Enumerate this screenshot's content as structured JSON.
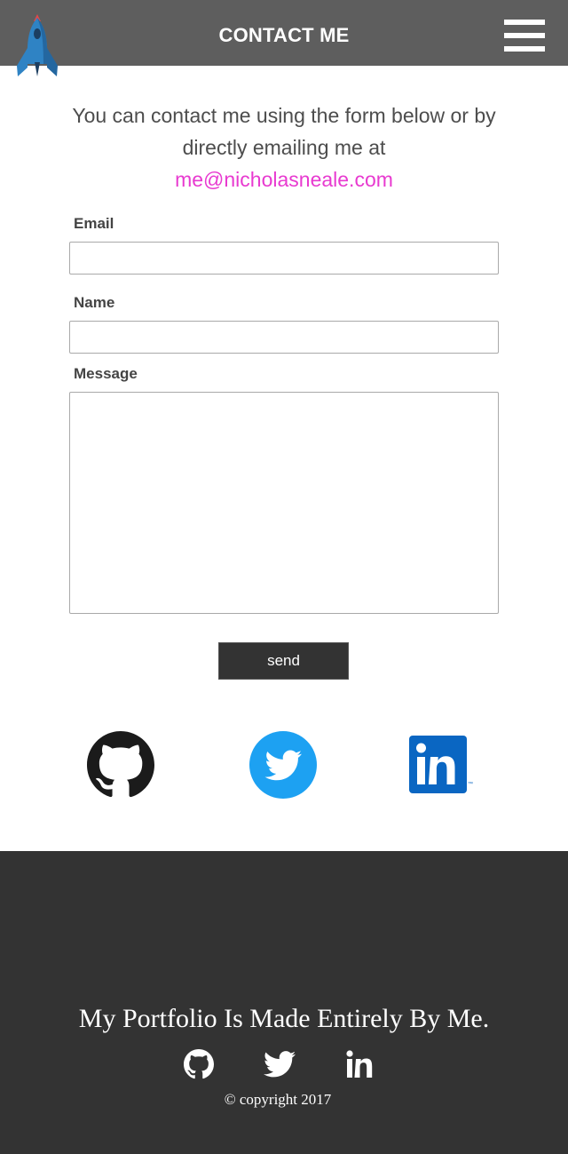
{
  "header": {
    "title": "CONTACT ME",
    "logo_icon": "rocket-icon",
    "menu_icon": "hamburger-menu-icon"
  },
  "intro": {
    "text": "You can contact me using the form below or by directly emailing me at",
    "email": "me@nicholasneale.com"
  },
  "form": {
    "email_label": "Email",
    "email_value": "",
    "name_label": "Name",
    "name_value": "",
    "message_label": "Message",
    "message_value": "",
    "send_label": "send"
  },
  "social": [
    {
      "name": "github",
      "icon": "github-icon"
    },
    {
      "name": "twitter",
      "icon": "twitter-icon"
    },
    {
      "name": "linkedin",
      "icon": "linkedin-icon"
    }
  ],
  "footer": {
    "tagline": "My Portfolio Is Made Entirely By Me.",
    "copyright": "© copyright 2017"
  },
  "colors": {
    "header_bg": "#5e5e5e",
    "link": "#e83ad0",
    "button_bg": "#333333",
    "footer_bg": "#333333",
    "twitter_blue": "#1da1f2",
    "linkedin_blue": "#0a66c2"
  }
}
